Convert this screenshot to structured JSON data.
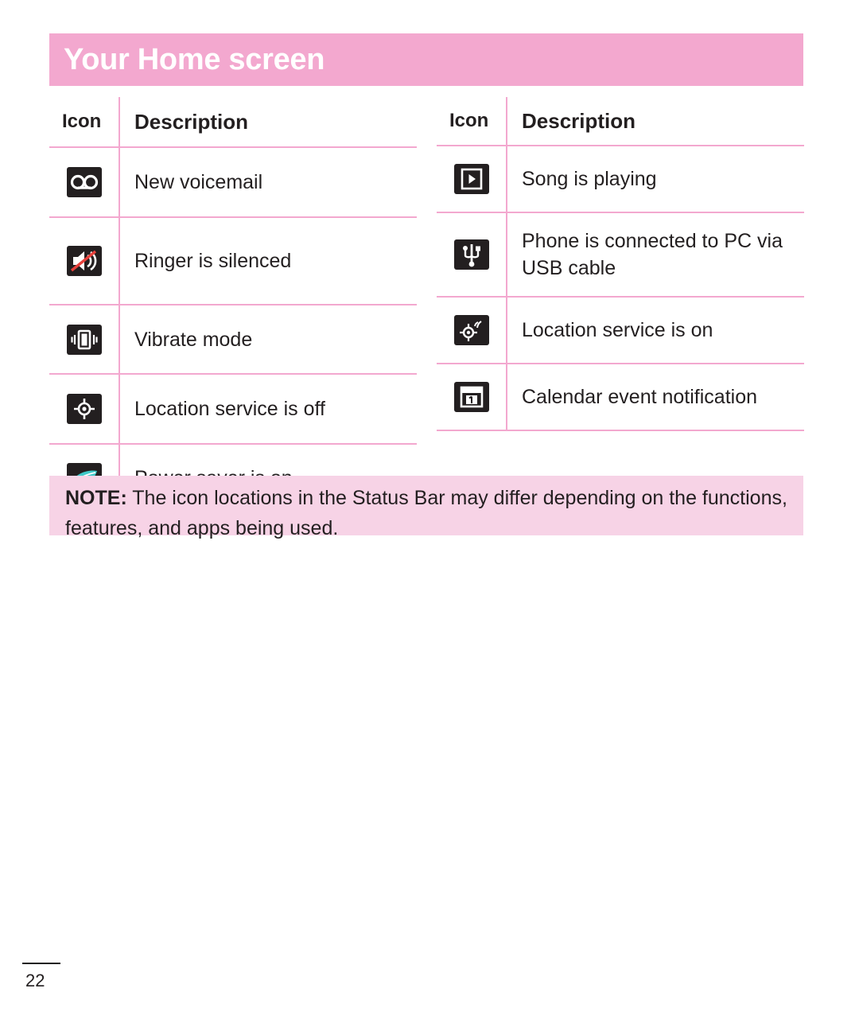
{
  "header": {
    "title": "Your Home screen"
  },
  "tables": [
    {
      "headers": {
        "icon": "Icon",
        "description": "Description"
      },
      "rows": [
        {
          "icon": "voicemail-icon",
          "description": "New voicemail"
        },
        {
          "icon": "ringer-silenced-icon",
          "description": "Ringer is silenced"
        },
        {
          "icon": "vibrate-mode-icon",
          "description": "Vibrate mode"
        },
        {
          "icon": "location-off-icon",
          "description": "Location service is off"
        },
        {
          "icon": "power-saver-icon",
          "description": "Power saver is on"
        }
      ]
    },
    {
      "headers": {
        "icon": "Icon",
        "description": "Description"
      },
      "rows": [
        {
          "icon": "play-icon",
          "description": "Song is playing"
        },
        {
          "icon": "usb-icon",
          "description": "Phone is connected to PC via USB cable"
        },
        {
          "icon": "location-on-icon",
          "description": "Location service is on"
        },
        {
          "icon": "calendar-icon",
          "description": "Calendar event notification"
        }
      ]
    }
  ],
  "note": {
    "label": "NOTE:",
    "text": " The icon locations in the Status Bar may differ depending on the functions, features, and apps being used."
  },
  "footer": {
    "page_number": "22"
  },
  "colors": {
    "accent": "#f3a8cf",
    "note_background": "#f7d3e6",
    "text": "#231f20"
  }
}
